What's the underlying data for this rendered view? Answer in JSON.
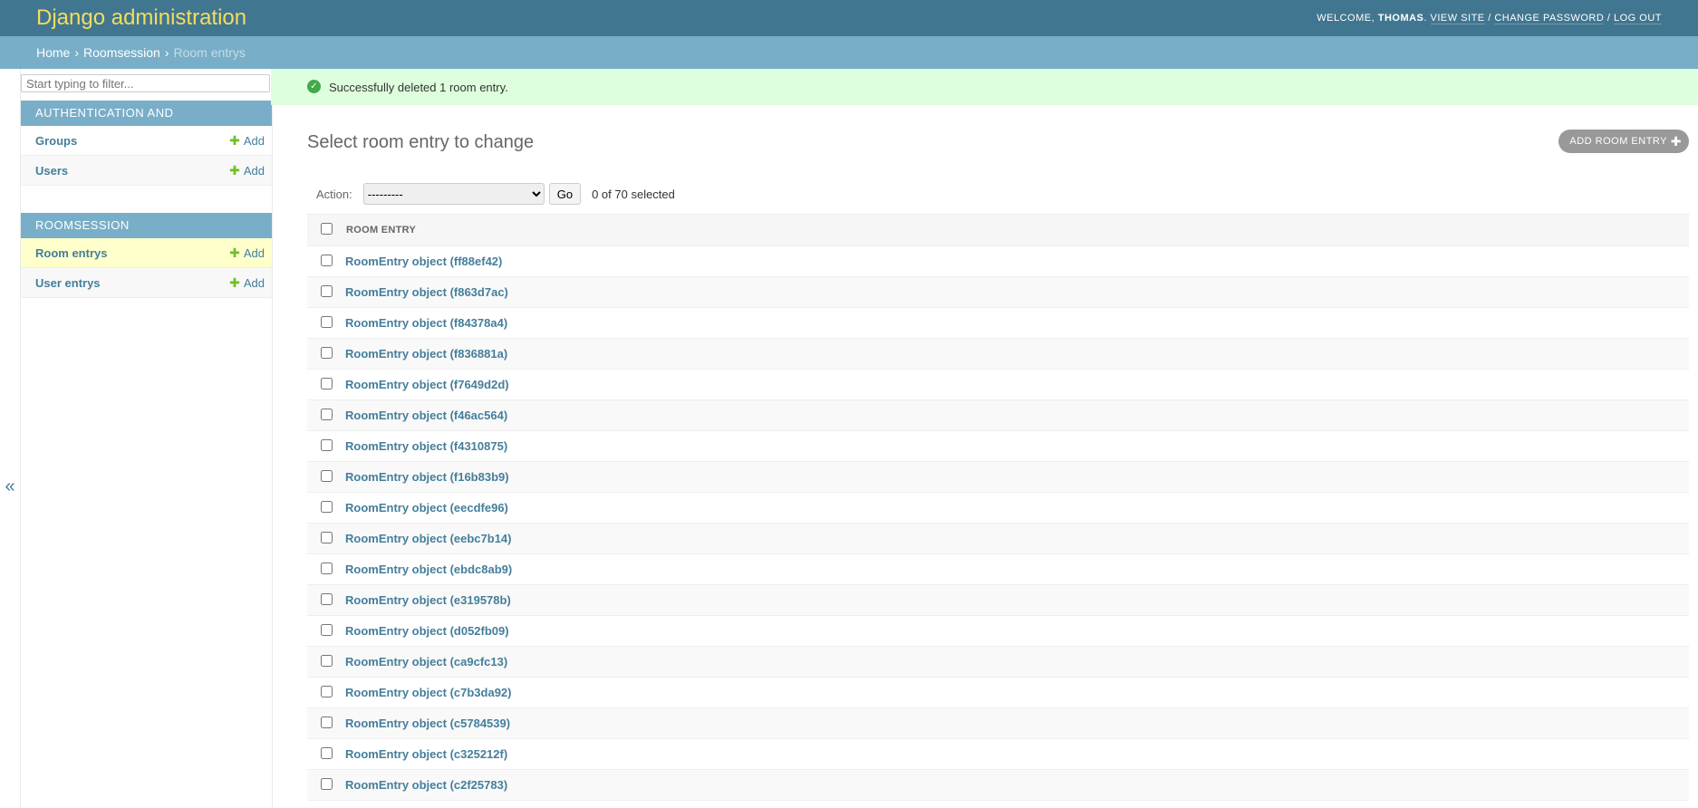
{
  "header": {
    "branding": "Django administration",
    "welcome": "Welcome,",
    "username": "Thomas",
    "view_site": "View site",
    "change_password": "Change password",
    "log_out": "Log out"
  },
  "breadcrumbs": {
    "home": "Home",
    "app": "Roomsession",
    "current": "Room entrys"
  },
  "sidebar": {
    "filter_placeholder": "Start typing to filter...",
    "modules": [
      {
        "caption": "Authentication and Authorization",
        "rows": [
          {
            "label": "Groups",
            "add": "Add"
          },
          {
            "label": "Users",
            "add": "Add"
          }
        ]
      },
      {
        "caption": "Roomsession",
        "rows": [
          {
            "label": "Room entrys",
            "add": "Add"
          },
          {
            "label": "User entrys",
            "add": "Add"
          }
        ]
      }
    ],
    "collapse_icon": "«"
  },
  "messages": {
    "success": "Successfully deleted 1 room entry."
  },
  "content": {
    "title": "Select room entry to change",
    "add_button": "Add room entry",
    "action_label": "Action:",
    "action_selected": "---------",
    "go_label": "Go",
    "counter": "0 of 70 selected",
    "column_header": "Room entry",
    "rows": [
      "RoomEntry object (ff88ef42)",
      "RoomEntry object (f863d7ac)",
      "RoomEntry object (f84378a4)",
      "RoomEntry object (f836881a)",
      "RoomEntry object (f7649d2d)",
      "RoomEntry object (f46ac564)",
      "RoomEntry object (f4310875)",
      "RoomEntry object (f16b83b9)",
      "RoomEntry object (eecdfe96)",
      "RoomEntry object (eebc7b14)",
      "RoomEntry object (ebdc8ab9)",
      "RoomEntry object (e319578b)",
      "RoomEntry object (d052fb09)",
      "RoomEntry object (ca9cfc13)",
      "RoomEntry object (c7b3da92)",
      "RoomEntry object (c5784539)",
      "RoomEntry object (c325212f)",
      "RoomEntry object (c2f25783)"
    ]
  }
}
